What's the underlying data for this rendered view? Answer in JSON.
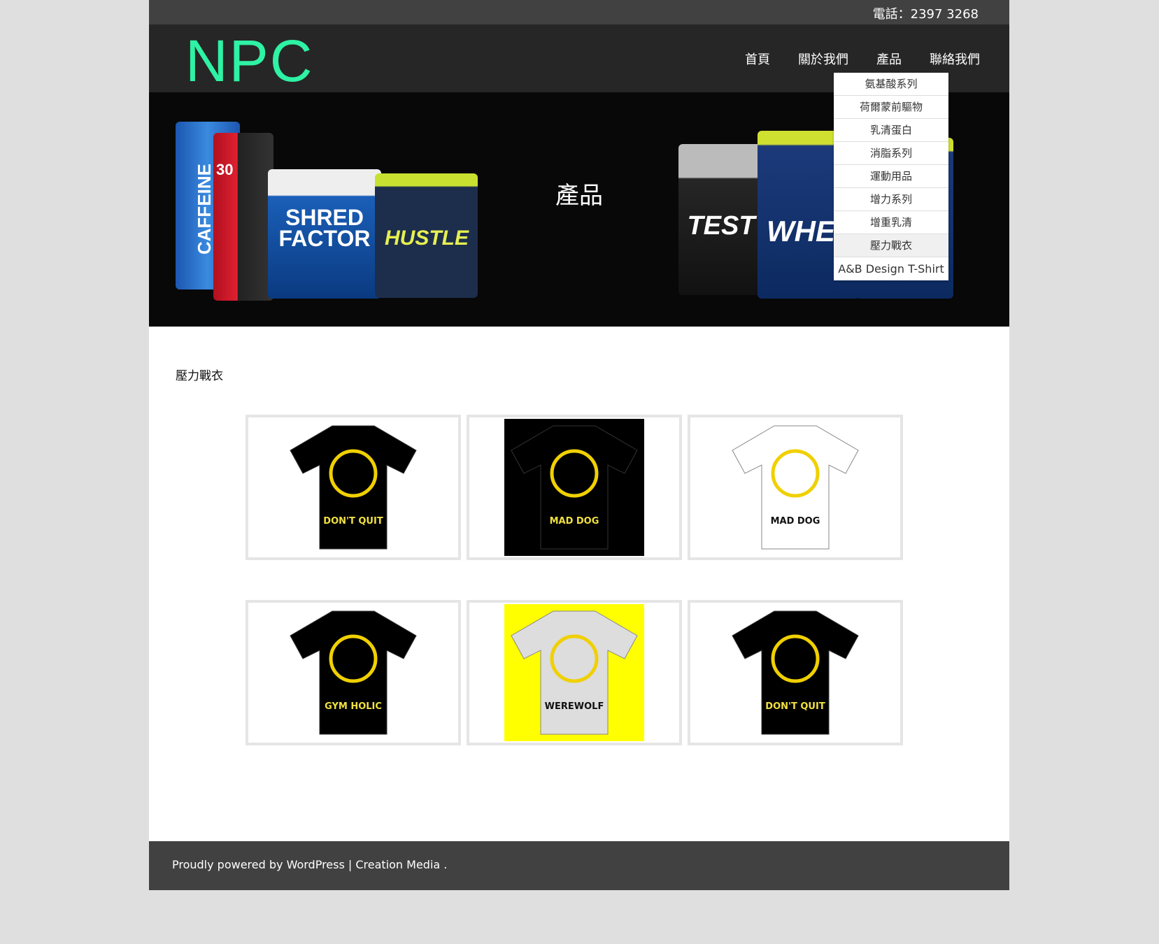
{
  "topbar": {
    "phone": "電話：2397 3268"
  },
  "header": {
    "logo": "NPC",
    "nav": [
      {
        "label": "首頁"
      },
      {
        "label": "關於我們"
      },
      {
        "label": "產品"
      },
      {
        "label": "聯絡我們"
      }
    ]
  },
  "dropdown": {
    "items": [
      {
        "label": "氨基酸系列"
      },
      {
        "label": "荷爾蒙前驅物"
      },
      {
        "label": "乳清蛋白"
      },
      {
        "label": "消脂系列"
      },
      {
        "label": "運動用品"
      },
      {
        "label": "增力系列"
      },
      {
        "label": "增重乳清"
      },
      {
        "label": "壓力戰衣",
        "active": true
      },
      {
        "label": "A&B Design T-Shirt"
      }
    ]
  },
  "hero": {
    "title": "產品",
    "products": {
      "caffeine": "CAFFEINE",
      "shred": "SHRED FACTOR",
      "shred_count": "30",
      "hustle": "HUSTLE",
      "test": "TEST",
      "whey": "WHEY"
    }
  },
  "content": {
    "title": "壓力戰衣",
    "shirts": [
      {
        "small_text": "DON'T QUIT",
        "bg": "#ffffff",
        "shirt": "#000000"
      },
      {
        "small_text": "MAD DOG",
        "bg": "#000000",
        "shirt": "#000000"
      },
      {
        "small_text": "MAD DOG",
        "bg": "#ffffff",
        "shirt": "#ffffff"
      },
      {
        "small_text": "GYM HOLIC",
        "bg": "#ffffff",
        "shirt": "#000000"
      },
      {
        "small_text": "WEREWOLF",
        "bg": "#ffff00",
        "shirt": "#dddddd"
      },
      {
        "small_text": "DON'T QUIT",
        "bg": "#ffffff",
        "shirt": "#000000"
      }
    ]
  },
  "footer": {
    "text": "Proudly powered by WordPress",
    "sep": " | ",
    "link": "Creation Media",
    "end": " ."
  }
}
